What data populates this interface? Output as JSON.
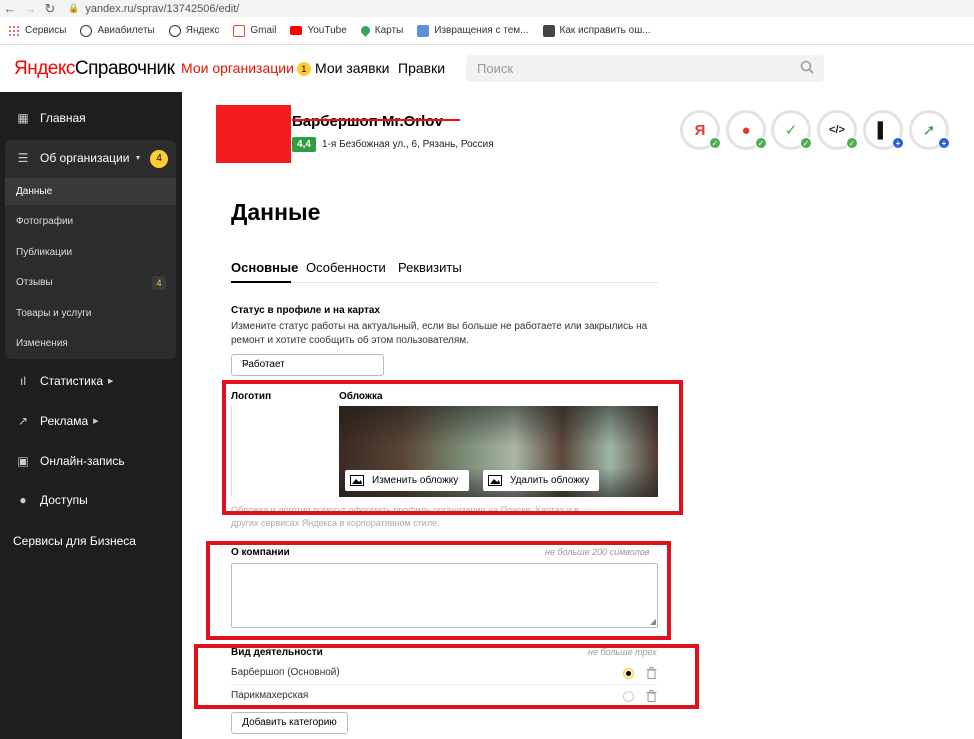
{
  "browser": {
    "url": "yandex.ru/sprav/13742506/edit/",
    "bookmarks": [
      {
        "label": "Сервисы",
        "color": "#e53935"
      },
      {
        "label": "Авиабилеты",
        "color": "#333333"
      },
      {
        "label": "Яндекс",
        "color": "#333333"
      },
      {
        "label": "Gmail",
        "color": "#ea4335"
      },
      {
        "label": "YouTube",
        "color": "#ff0000"
      },
      {
        "label": "Карты",
        "color": "#34a853"
      },
      {
        "label": "Извращения с тем...",
        "color": "#5b8fd6"
      },
      {
        "label": "Как исправить ош...",
        "color": "#444444"
      }
    ]
  },
  "header": {
    "logo_ya": "Яндекс",
    "logo_sp": "Справочник",
    "nav": {
      "orgs": "Мои организации",
      "orgs_count": "1",
      "requests": "Мои заявки",
      "rules": "Правки"
    },
    "search_placeholder": "Поиск"
  },
  "sidebar": {
    "home": "Главная",
    "about": "Об организации",
    "about_count": "4",
    "subs": {
      "data": "Данные",
      "photos": "Фотографии",
      "posts": "Публикации",
      "reviews": "Отзывы",
      "reviews_count": "4",
      "goods": "Товары и услуги",
      "changes": "Изменения"
    },
    "stats": "Статистика",
    "ads": "Реклама",
    "booking": "Онлайн-запись",
    "access": "Доступы",
    "business": "Сервисы для Бизнеса"
  },
  "org": {
    "name": "Барбершоп Mr.Orlov",
    "rating": "4,4",
    "address": "1-я Безбожная ул., 6, Рязань, Россия",
    "services": [
      {
        "icon": "yandex-icon",
        "glyph": "Я",
        "color": "#e53935",
        "state": "check"
      },
      {
        "icon": "maps-pin-icon",
        "glyph": "●",
        "color": "#e53935",
        "state": "check"
      },
      {
        "icon": "check-service-icon",
        "glyph": "✓",
        "color": "#33aa44",
        "state": "check"
      },
      {
        "icon": "code-icon",
        "glyph": "</>",
        "color": "#222222",
        "state": "check"
      },
      {
        "icon": "zen-icon",
        "glyph": "▌",
        "color": "#111111",
        "state": "plus"
      },
      {
        "icon": "arrow-up-icon",
        "glyph": "➚",
        "color": "#2e9e45",
        "state": "plus"
      }
    ]
  },
  "content": {
    "title": "Данные",
    "tabs": [
      "Основные",
      "Особенности",
      "Реквизиты"
    ],
    "status": {
      "label": "Статус в профиле и на картах",
      "desc1": "Измените статус работы на актуальный, если вы больше не работаете или закрылись на",
      "desc2": "ремонт и хотите сообщить об этом пользователям.",
      "value": "Работает"
    },
    "media": {
      "logo_label": "Логотип",
      "cover_label": "Обложка",
      "change_cover": "Изменить обложку",
      "delete_cover": "Удалить обложку",
      "hint1": "Обложка и логотип помогут оформить профиль организации на Поиске, Картах и в",
      "hint2": "других сервисах Яндекса в корпоративном стиле."
    },
    "about": {
      "label": "О компании",
      "limit": "не больше 200 символов"
    },
    "activity": {
      "label": "Вид деятельности",
      "limit": "не больше трех",
      "items": [
        {
          "name": "Барбершоп (Основной)",
          "main": true
        },
        {
          "name": "Парикмахерская",
          "main": false
        }
      ],
      "add_button": "Добавить категорию"
    }
  }
}
